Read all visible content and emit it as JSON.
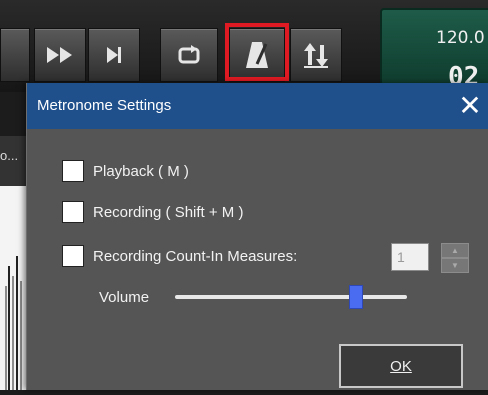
{
  "toolbar": {
    "buttons": [
      {
        "name": "rewind-button",
        "icon": "rewind-icon"
      },
      {
        "name": "fast-forward-button",
        "icon": "fast-forward-icon"
      },
      {
        "name": "skip-to-end-button",
        "icon": "skip-to-end-icon"
      },
      {
        "name": "loop-button",
        "icon": "loop-icon"
      },
      {
        "name": "metronome-button",
        "icon": "metronome-icon",
        "highlighted": true
      },
      {
        "name": "sync-button",
        "icon": "up-down-arrows-icon"
      }
    ],
    "highlight_color": "#e01a22"
  },
  "display": {
    "tempo": "120.0",
    "counter": "02"
  },
  "side_label": "o...",
  "dialog": {
    "title": "Metronome Settings",
    "close_icon": "close-icon",
    "options": [
      {
        "label": "Playback ( M )",
        "checked": false
      },
      {
        "label": "Recording ( Shift + M )",
        "checked": false
      },
      {
        "label": "Recording Count-In Measures:",
        "checked": false
      }
    ],
    "count_in_value": "1",
    "volume_label": "Volume",
    "volume_level": 0.78,
    "ok_label": "OK"
  },
  "colors": {
    "title_bar": "#20508c",
    "dialog_bg": "#555555",
    "slider_thumb": "#4a6cf0",
    "display_bg": "#1e5b48"
  }
}
